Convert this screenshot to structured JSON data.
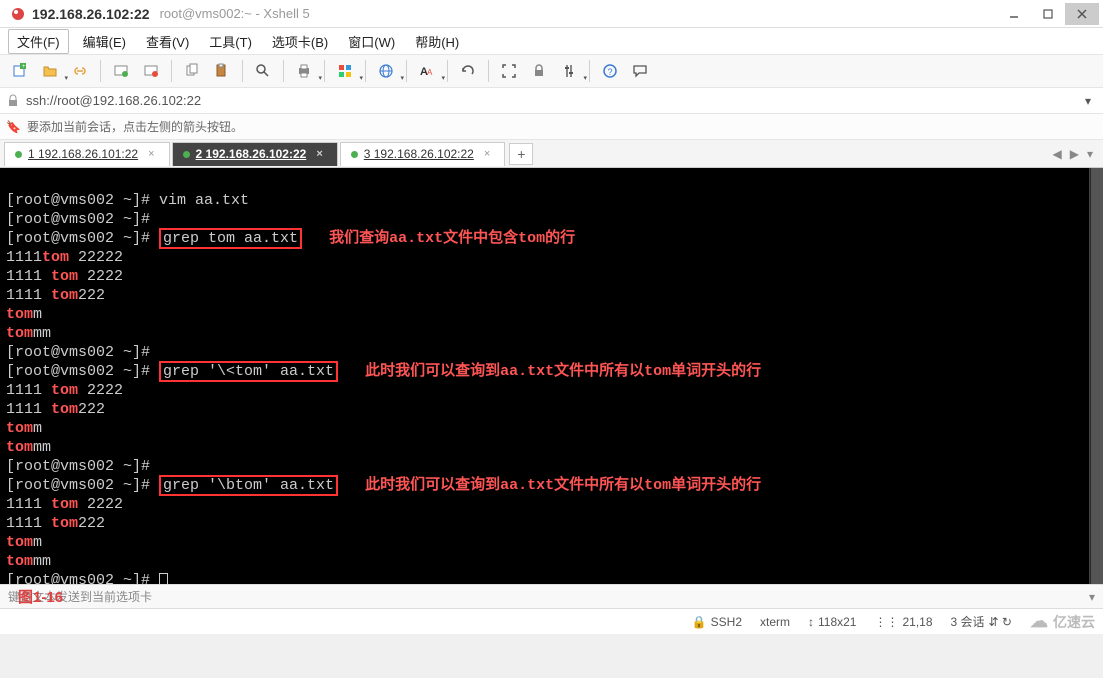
{
  "title": {
    "host": "192.168.26.102:22",
    "subtitle": "root@vms002:~ - Xshell 5"
  },
  "menu": {
    "file": "文件(F)",
    "edit": "编辑(E)",
    "view": "查看(V)",
    "tools": "工具(T)",
    "tabs": "选项卡(B)",
    "window": "窗口(W)",
    "help": "帮助(H)"
  },
  "address": {
    "url": "ssh://root@192.168.26.102:22"
  },
  "infobar": {
    "text": "要添加当前会话，点击左侧的箭头按钮。"
  },
  "tabs": {
    "items": [
      {
        "label": "1 192.168.26.101:22",
        "active": false
      },
      {
        "label": "2 192.168.26.102:22",
        "active": true
      },
      {
        "label": "3 192.168.26.102:22",
        "active": false
      }
    ]
  },
  "terminal": {
    "prompt": "[root@vms002 ~]# ",
    "cmd_vim": "vim aa.txt",
    "cmd_grep1": "grep tom aa.txt",
    "ann1": "我们查询aa.txt文件中包含tom的行",
    "r1a": "1111",
    "r1b": "tom",
    "r1c": " 22222",
    "r2a": "1111 ",
    "r2b": "tom",
    "r2c": " 2222",
    "r3a": "1111 ",
    "r3b": "tom",
    "r3c": "222",
    "r4a": "tom",
    "r4b": "m",
    "r5a": "tom",
    "r5b": "mm",
    "cmd_grep2": "grep '\\<tom' aa.txt",
    "ann2": "此时我们可以查询到aa.txt文件中所有以tom单词开头的行",
    "cmd_grep3": "grep '\\btom' aa.txt",
    "ann3": "此时我们可以查询到aa.txt文件中所有以tom单词开头的行"
  },
  "footer": {
    "hint": "键盘文本发送到当前选项卡",
    "figlabel": "图1-16"
  },
  "status": {
    "proto": "SSH2",
    "term": "xterm",
    "size": "118x21",
    "pos": "21,18",
    "sess": "3 会话"
  },
  "logo": "亿速云",
  "icons": {
    "new_session": "new-session",
    "open": "open",
    "link": "link",
    "online": "online",
    "offline": "offline",
    "copy": "copy",
    "paste": "paste",
    "search": "search",
    "print": "print",
    "color": "color",
    "globe": "globe",
    "font": "font",
    "refresh": "refresh",
    "fullscreen": "fullscreen",
    "lock": "lock",
    "settings": "settings",
    "help": "help",
    "chat": "chat"
  }
}
